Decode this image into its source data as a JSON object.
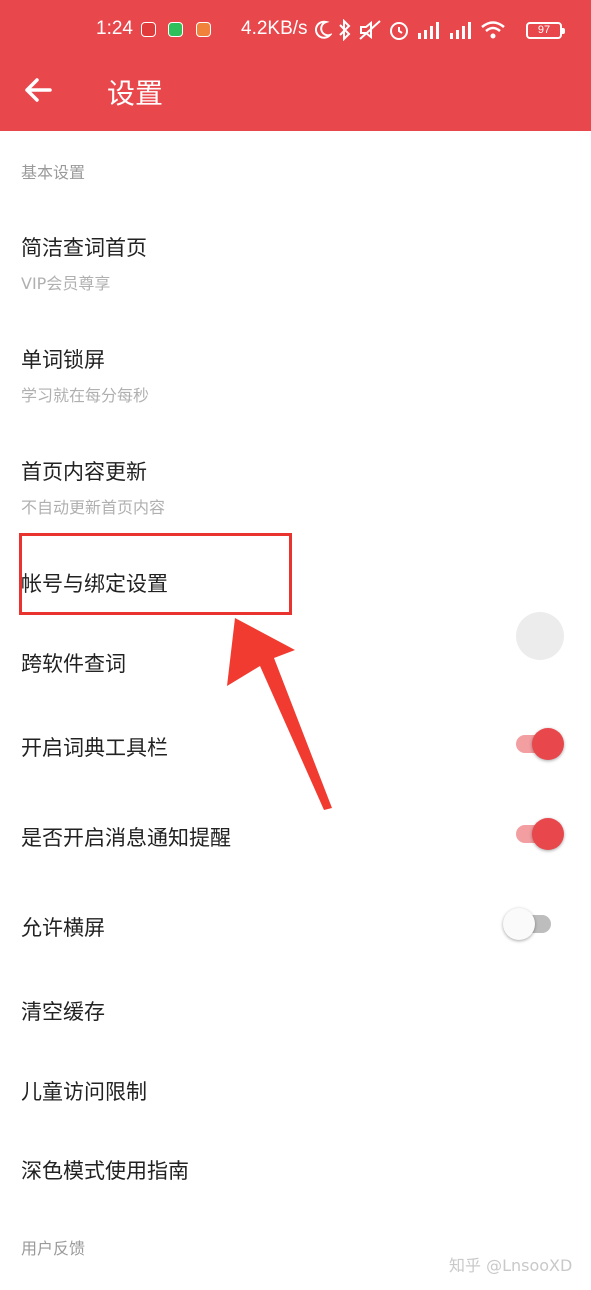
{
  "status_bar": {
    "time": "1:24",
    "network_speed": "4.2KB/s",
    "battery": "97",
    "icons": [
      "moon-icon",
      "bluetooth-icon",
      "mute-icon",
      "alarm-icon",
      "signal-icon",
      "signal-icon",
      "wifi-icon"
    ]
  },
  "app_bar": {
    "title": "设置",
    "back_icon": "arrow-left-icon"
  },
  "sections": {
    "basic": "基本设置",
    "feedback": "用户反馈"
  },
  "rows": {
    "simple_home": {
      "title": "简洁查词首页",
      "subtitle": "VIP会员尊享"
    },
    "word_lock": {
      "title": "单词锁屏",
      "subtitle": "学习就在每分每秒"
    },
    "home_update": {
      "title": "首页内容更新",
      "subtitle": "不自动更新首页内容"
    },
    "account": {
      "title": "帐号与绑定设置"
    },
    "cross_app": {
      "title": "跨软件查词"
    },
    "toolbar": {
      "title": "开启词典工具栏",
      "enabled": true
    },
    "notifications": {
      "title": "是否开启消息通知提醒",
      "enabled": true
    },
    "landscape": {
      "title": "允许横屏",
      "enabled": false
    },
    "clear_cache": {
      "title": "清空缓存"
    },
    "child_limit": {
      "title": "儿童访问限制"
    },
    "dark_guide": {
      "title": "深色模式使用指南"
    }
  },
  "colors": {
    "accent": "#e8474c",
    "annotation": "#e8332e"
  },
  "watermark": "知乎 @LnsooXD"
}
